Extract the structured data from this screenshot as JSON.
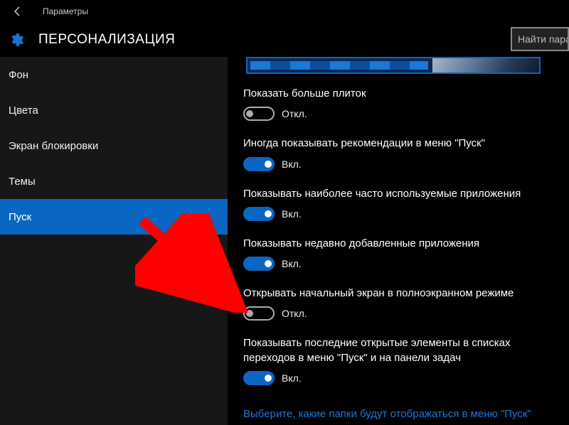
{
  "window": {
    "title": "Параметры"
  },
  "header": {
    "title": "ПЕРСОНАЛИЗАЦИЯ",
    "search_placeholder": "Найти пара"
  },
  "sidebar": {
    "items": [
      {
        "label": "Фон",
        "active": false
      },
      {
        "label": "Цвета",
        "active": false
      },
      {
        "label": "Экран блокировки",
        "active": false
      },
      {
        "label": "Темы",
        "active": false
      },
      {
        "label": "Пуск",
        "active": true
      }
    ]
  },
  "toggle_labels": {
    "on": "Вкл.",
    "off": "Откл."
  },
  "settings": [
    {
      "label": "Показать больше плиток",
      "state": "off"
    },
    {
      "label": "Иногда показывать рекомендации в меню \"Пуск\"",
      "state": "on"
    },
    {
      "label": "Показывать наиболее часто используемые приложения",
      "state": "on"
    },
    {
      "label": "Показывать недавно добавленные приложения",
      "state": "on"
    },
    {
      "label": "Открывать начальный экран в полноэкранном режиме",
      "state": "off"
    },
    {
      "label": "Показывать последние открытые элементы в списках переходов в меню \"Пуск\" и на панели задач",
      "state": "on"
    }
  ],
  "link": {
    "label": "Выберите, какие папки будут отображаться в меню \"Пуск\""
  },
  "annotation": {
    "color": "#ff0000"
  }
}
